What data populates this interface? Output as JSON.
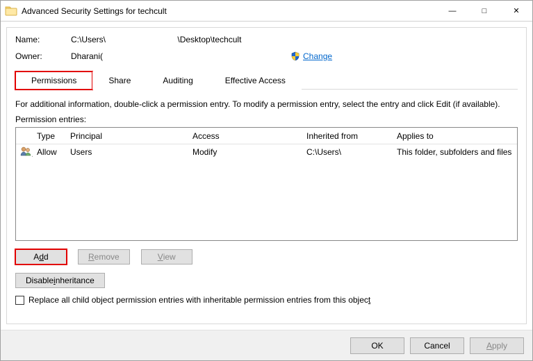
{
  "window": {
    "title": "Advanced Security Settings for techcult"
  },
  "fields": {
    "name_label": "Name:",
    "name_value": "C:\\Users\\                               \\Desktop\\techcult",
    "owner_label": "Owner:",
    "owner_value": "Dharani(",
    "change_label": "Change"
  },
  "tabs": {
    "permissions": "Permissions",
    "share": "Share",
    "auditing": "Auditing",
    "effective": "Effective Access"
  },
  "info": "For additional information, double-click a permission entry. To modify a permission entry, select the entry and click Edit (if available).",
  "entries_label": "Permission entries:",
  "columns": {
    "type": "Type",
    "principal": "Principal",
    "access": "Access",
    "inherited": "Inherited from",
    "applies": "Applies to"
  },
  "rows": [
    {
      "type": "Allow",
      "principal": "Users",
      "access": "Modify",
      "inherited": "C:\\Users\\",
      "applies": "This folder, subfolders and files"
    }
  ],
  "buttons": {
    "add_pre": "A",
    "add_post": "dd",
    "remove_pre": "R",
    "remove_post": "emove",
    "view_pre": "V",
    "view_post": "iew",
    "disable_pre": "Disable ",
    "disable_u": "i",
    "disable_post": "nheritance"
  },
  "checkbox": {
    "pre": "Replace all child object permission entries with inheritable permission entries from this objec",
    "u": "t",
    "post": ""
  },
  "footer": {
    "ok": "OK",
    "cancel": "Cancel",
    "apply_pre": "",
    "apply_u": "A",
    "apply_post": "pply"
  }
}
